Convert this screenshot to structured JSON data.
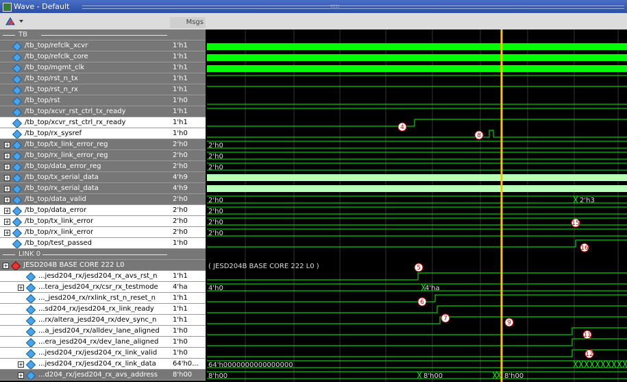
{
  "window": {
    "title": "Wave - Default"
  },
  "toolbar": {
    "msgs_label": "Msgs"
  },
  "groups": {
    "tb": "TB",
    "link0": "LINK 0"
  },
  "signals": [
    {
      "name": "/tb_top/refclk_xcvr",
      "value": "1'h1",
      "style": "gray",
      "expand": false,
      "icon": "signal-diamond-icon"
    },
    {
      "name": "/tb_top/refclk_core",
      "value": "1'h1",
      "style": "gray",
      "expand": false,
      "icon": "signal-diamond-icon"
    },
    {
      "name": "/tb_top/mgmt_clk",
      "value": "1'h1",
      "style": "gray",
      "expand": false,
      "icon": "signal-diamond-icon"
    },
    {
      "name": "/tb_top/rst_n_tx",
      "value": "1'h1",
      "style": "gray",
      "expand": false,
      "icon": "signal-diamond-icon"
    },
    {
      "name": "/tb_top/rst_n_rx",
      "value": "1'h1",
      "style": "gray",
      "expand": false,
      "icon": "signal-diamond-icon"
    },
    {
      "name": "/tb_top/rst",
      "value": "1'h0",
      "style": "gray",
      "expand": false,
      "icon": "signal-diamond-icon"
    },
    {
      "name": "/tb_top/xcvr_rst_ctrl_tx_ready",
      "value": "1'h1",
      "style": "gray",
      "expand": false,
      "icon": "signal-diamond-icon"
    },
    {
      "name": "/tb_top/xcvr_rst_ctrl_rx_ready",
      "value": "1'h1",
      "style": "white",
      "expand": false,
      "icon": "signal-diamond-icon"
    },
    {
      "name": "/tb_top/rx_sysref",
      "value": "1'h0",
      "style": "white",
      "expand": false,
      "icon": "signal-diamond-icon"
    },
    {
      "name": "/tb_top/tx_link_error_reg",
      "value": "2'h0",
      "style": "gray",
      "expand": true,
      "icon": "signal-diamond-icon"
    },
    {
      "name": "/tb_top/rx_link_error_reg",
      "value": "2'h0",
      "style": "gray",
      "expand": true,
      "icon": "signal-diamond-icon"
    },
    {
      "name": "/tb_top/data_error_reg",
      "value": "2'h0",
      "style": "gray",
      "expand": true,
      "icon": "signal-diamond-icon"
    },
    {
      "name": "/tb_top/tx_serial_data",
      "value": "4'h9",
      "style": "gray",
      "expand": true,
      "icon": "signal-diamond-icon"
    },
    {
      "name": "/tb_top/rx_serial_data",
      "value": "4'h9",
      "style": "gray",
      "expand": true,
      "icon": "signal-diamond-icon"
    },
    {
      "name": "/tb_top/data_valid",
      "value": "2'h0",
      "style": "gray",
      "expand": true,
      "icon": "signal-diamond-icon"
    },
    {
      "name": "/tb_top/data_error",
      "value": "2'h0",
      "style": "white",
      "expand": true,
      "icon": "signal-diamond-icon"
    },
    {
      "name": "/tb_top/tx_link_error",
      "value": "2'h0",
      "style": "white",
      "expand": true,
      "icon": "signal-diamond-icon"
    },
    {
      "name": "/tb_top/rx_link_error",
      "value": "2'h0",
      "style": "white",
      "expand": true,
      "icon": "signal-diamond-icon"
    },
    {
      "name": "/tb_top/test_passed",
      "value": "1'h0",
      "style": "white",
      "expand": false,
      "icon": "signal-diamond-icon"
    },
    {
      "name": "JESD204B BASE CORE 222 L0",
      "value": "",
      "style": "gray",
      "expand": true,
      "icon": "group-red-diamond-icon"
    },
    {
      "name": "...jesd204_rx/jesd204_rx_avs_rst_n",
      "value": "1'h1",
      "style": "white",
      "expand": false,
      "icon": "port-in-icon"
    },
    {
      "name": "...tera_jesd204_rx/csr_rx_testmode",
      "value": "4'ha",
      "style": "white",
      "expand": true,
      "icon": "port-in-icon"
    },
    {
      "name": "..._jesd204_rx/rxlink_rst_n_reset_n",
      "value": "1'h1",
      "style": "white",
      "expand": false,
      "icon": "port-in-icon"
    },
    {
      "name": "...sd204_rx/jesd204_rx_link_ready",
      "value": "1'h1",
      "style": "white",
      "expand": false,
      "icon": "port-in-icon"
    },
    {
      "name": "...rx/altera_jesd204_rx/dev_sync_n",
      "value": "1'h1",
      "style": "white",
      "expand": false,
      "icon": "port-in-icon"
    },
    {
      "name": "...a_jesd204_rx/alldev_lane_aligned",
      "value": "1'h0",
      "style": "white",
      "expand": false,
      "icon": "port-in-icon"
    },
    {
      "name": "...era_jesd204_rx/dev_lane_aligned",
      "value": "1'h0",
      "style": "white",
      "expand": false,
      "icon": "port-in-icon"
    },
    {
      "name": "...jesd204_rx/jesd204_rx_link_valid",
      "value": "1'h0",
      "style": "white",
      "expand": false,
      "icon": "port-in-icon"
    },
    {
      "name": "...jesd204_rx/jesd204_rx_link_data",
      "value": "64'h0...",
      "style": "white",
      "expand": true,
      "icon": "port-in-icon"
    },
    {
      "name": "...d204_rx/jesd204_rx_avs_address",
      "value": "8'h00",
      "style": "gray",
      "expand": true,
      "icon": "port-in-icon"
    }
  ],
  "wave_labels": {
    "tx_link_error_reg": "2'h0",
    "rx_link_error_reg": "2'h0",
    "data_error_reg": "2'h0",
    "data_valid_a": "2'h0",
    "data_valid_b": "2'h3",
    "data_error": "2'h0",
    "tx_link_error": "2'h0",
    "rx_link_error": "2'h0",
    "core_group": "( JESD204B BASE CORE 222 L0 )",
    "testmode_a": "4'h0",
    "testmode_b": "4'ha",
    "link_data": "64'h0000000000000000",
    "avs_address_a": "8'h00",
    "avs_address_b": "8'h00",
    "avs_address_c": "8'h00"
  },
  "markers": [
    "3",
    "4",
    "5",
    "6",
    "7",
    "8",
    "9",
    "11",
    "12",
    "15",
    "16"
  ],
  "colors": {
    "wave": "#00ff00",
    "bus_fill": "#b8ffb8",
    "cursor": "#ffc107",
    "marker_ring": "#cc0000"
  }
}
